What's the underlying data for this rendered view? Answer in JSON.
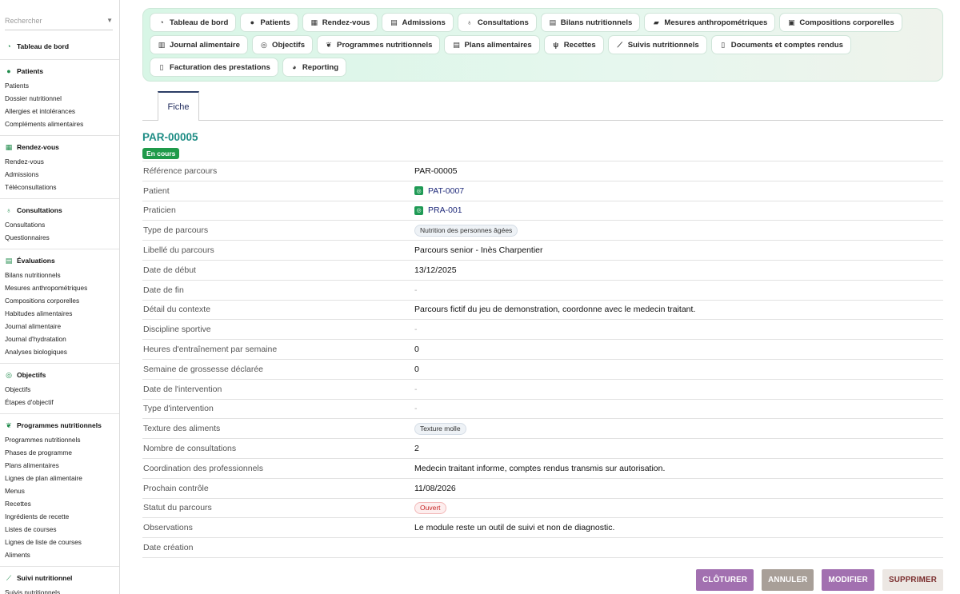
{
  "search": {
    "placeholder": "Rechercher"
  },
  "sidebar": {
    "sections": [
      {
        "title": "Tableau de bord",
        "icon": "dashboard-icon",
        "items": []
      },
      {
        "title": "Patients",
        "icon": "user-icon",
        "items": [
          "Patients",
          "Dossier nutritionnel",
          "Allergies et intolérances",
          "Compléments alimentaires"
        ]
      },
      {
        "title": "Rendez-vous",
        "icon": "calendar-icon",
        "items": [
          "Rendez-vous",
          "Admissions",
          "Téléconsultations"
        ]
      },
      {
        "title": "Consultations",
        "icon": "stethoscope-icon",
        "items": [
          "Consultations",
          "Questionnaires"
        ]
      },
      {
        "title": "Évaluations",
        "icon": "clipboard-icon",
        "items": [
          "Bilans nutritionnels",
          "Mesures anthropométriques",
          "Compositions corporelles",
          "Habitudes alimentaires",
          "Journal alimentaire",
          "Journal d'hydratation",
          "Analyses biologiques"
        ]
      },
      {
        "title": "Objectifs",
        "icon": "target-icon",
        "items": [
          "Objectifs",
          "Étapes d'objectif"
        ]
      },
      {
        "title": "Programmes nutritionnels",
        "icon": "sprout-icon",
        "items": [
          "Programmes nutritionnels",
          "Phases de programme",
          "Plans alimentaires",
          "Lignes de plan alimentaire",
          "Menus",
          "Recettes",
          "Ingrédients de recette",
          "Listes de courses",
          "Lignes de liste de courses",
          "Aliments"
        ]
      },
      {
        "title": "Suivi nutritionnel",
        "icon": "chart-line-icon",
        "items": [
          "Suivis nutritionnels"
        ]
      }
    ]
  },
  "modules": [
    {
      "label": "Tableau de bord",
      "icon": "dashboard-icon",
      "glyph": "◔"
    },
    {
      "label": "Patients",
      "icon": "user-icon",
      "glyph": "●"
    },
    {
      "label": "Rendez-vous",
      "icon": "calendar-icon",
      "glyph": "▦"
    },
    {
      "label": "Admissions",
      "icon": "clipboard-icon",
      "glyph": "▤"
    },
    {
      "label": "Consultations",
      "icon": "stethoscope-icon",
      "glyph": "♁"
    },
    {
      "label": "Bilans nutritionnels",
      "icon": "clipboard-icon",
      "glyph": "▤"
    },
    {
      "label": "Mesures anthropométriques",
      "icon": "ruler-icon",
      "glyph": "▰"
    },
    {
      "label": "Compositions corporelles",
      "icon": "scale-icon",
      "glyph": "▣"
    },
    {
      "label": "Journal alimentaire",
      "icon": "book-icon",
      "glyph": "▥"
    },
    {
      "label": "Objectifs",
      "icon": "target-icon",
      "glyph": "◎"
    },
    {
      "label": "Programmes nutritionnels",
      "icon": "sprout-icon",
      "glyph": "❦"
    },
    {
      "label": "Plans alimentaires",
      "icon": "clipboard-icon",
      "glyph": "▤"
    },
    {
      "label": "Recettes",
      "icon": "utensils-icon",
      "glyph": "ψ"
    },
    {
      "label": "Suivis nutritionnels",
      "icon": "chart-line-icon",
      "glyph": "⟋"
    },
    {
      "label": "Documents et comptes rendus",
      "icon": "document-icon",
      "glyph": "▯"
    },
    {
      "label": "Facturation des prestations",
      "icon": "invoice-icon",
      "glyph": "▯"
    },
    {
      "label": "Reporting",
      "icon": "pie-chart-icon",
      "glyph": "◕"
    }
  ],
  "tabs": {
    "active": "Fiche"
  },
  "record": {
    "id": "PAR-00005",
    "state": "En cours",
    "fields": [
      {
        "label": "Référence parcours",
        "value": "PAR-00005",
        "kind": "text"
      },
      {
        "label": "Patient",
        "value": "PAT-0007",
        "kind": "link"
      },
      {
        "label": "Praticien",
        "value": "PRA-001",
        "kind": "link"
      },
      {
        "label": "Type de parcours",
        "value": "Nutrition des personnes âgées",
        "kind": "pill"
      },
      {
        "label": "Libellé du parcours",
        "value": "Parcours senior - Inès Charpentier",
        "kind": "text"
      },
      {
        "label": "Date de début",
        "value": "13/12/2025",
        "kind": "text"
      },
      {
        "label": "Date de fin",
        "value": "-",
        "kind": "dash"
      },
      {
        "label": "Détail du contexte",
        "value": "Parcours fictif du jeu de demonstration, coordonne avec le medecin traitant.",
        "kind": "text"
      },
      {
        "label": "Discipline sportive",
        "value": "-",
        "kind": "dash"
      },
      {
        "label": "Heures d'entraînement par semaine",
        "value": "0",
        "kind": "text"
      },
      {
        "label": "Semaine de grossesse déclarée",
        "value": "0",
        "kind": "text"
      },
      {
        "label": "Date de l'intervention",
        "value": "-",
        "kind": "dash"
      },
      {
        "label": "Type d'intervention",
        "value": "-",
        "kind": "dash"
      },
      {
        "label": "Texture des aliments",
        "value": "Texture molle",
        "kind": "pill"
      },
      {
        "label": "Nombre de consultations",
        "value": "2",
        "kind": "text"
      },
      {
        "label": "Coordination des professionnels",
        "value": "Medecin traitant informe, comptes rendus transmis sur autorisation.",
        "kind": "text"
      },
      {
        "label": "Prochain contrôle",
        "value": "11/08/2026",
        "kind": "text"
      },
      {
        "label": "Statut du parcours",
        "value": "Ouvert",
        "kind": "pill-red"
      },
      {
        "label": "Observations",
        "value": "Le module reste un outil de suivi et non de diagnostic.",
        "kind": "text"
      },
      {
        "label": "Date création",
        "value": "",
        "kind": "text"
      }
    ]
  },
  "actions": {
    "close_label": "CLÔTURER",
    "cancel_label": "ANNULER",
    "edit_label": "MODIFIER",
    "delete_label": "SUPPRIMER"
  },
  "colors": {
    "accent": "#1d8c84",
    "state_badge": "#1f9a4a",
    "button_purple": "#a270b0",
    "button_grey": "#a89f98",
    "status_red": "#c62828"
  }
}
